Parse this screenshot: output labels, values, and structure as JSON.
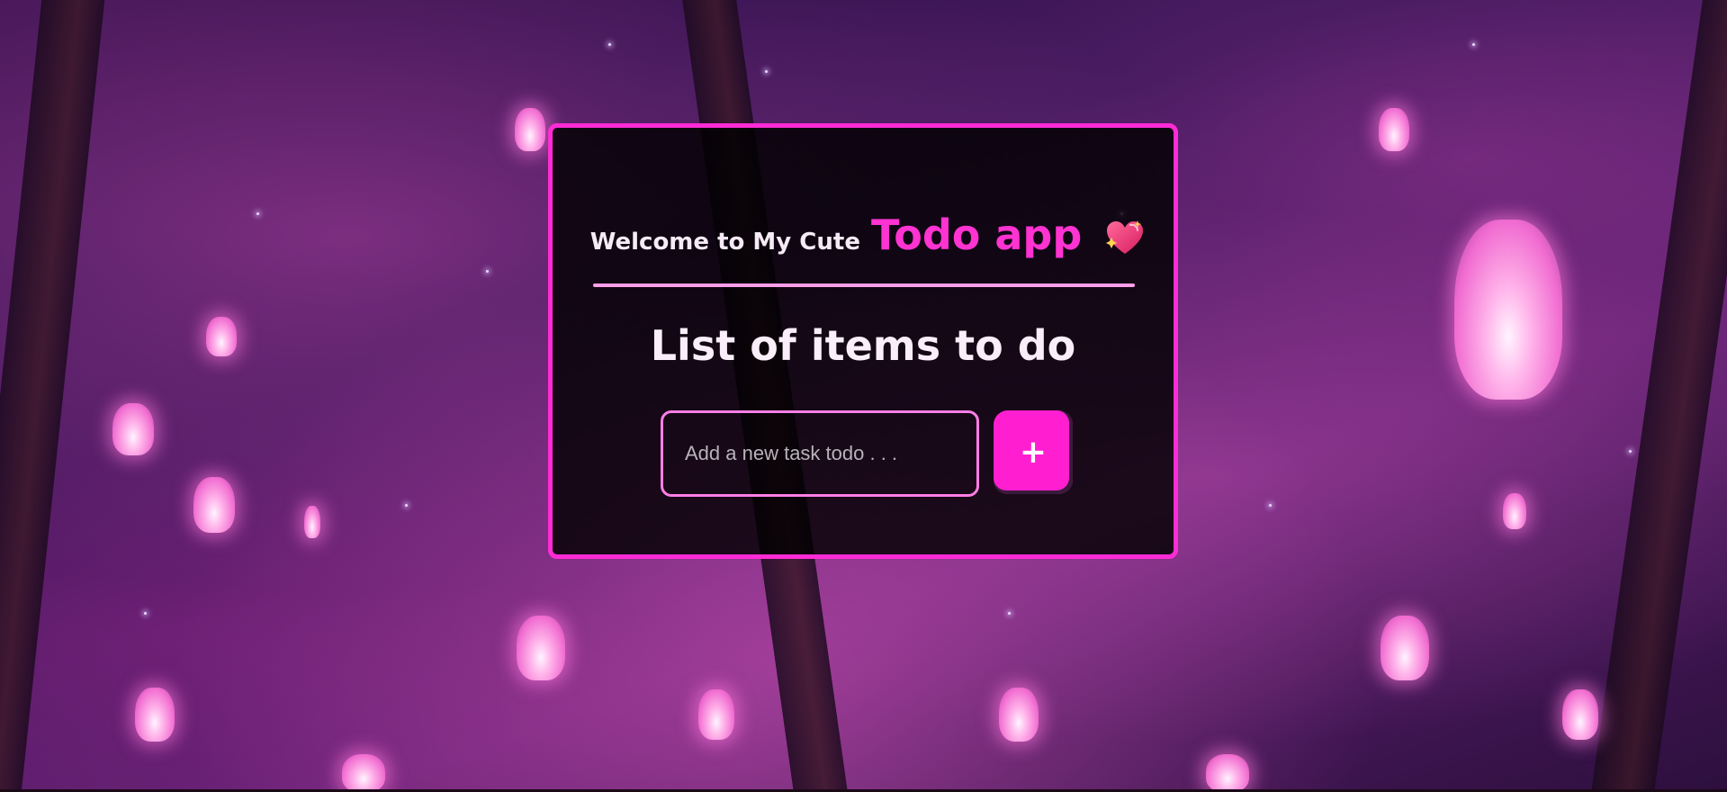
{
  "header": {
    "welcome": "Welcome to My Cute",
    "app_name": "Todo app",
    "heart_icon": "sparkling-heart-icon"
  },
  "main": {
    "heading": "List of items to do",
    "input_placeholder": "Add a new task todo . . .",
    "input_value": "",
    "add_label": "+"
  },
  "colors": {
    "accent": "#ff2bd6",
    "divider": "#ff9ee9",
    "button": "#ff1fd1",
    "card_bg": "#000000"
  }
}
